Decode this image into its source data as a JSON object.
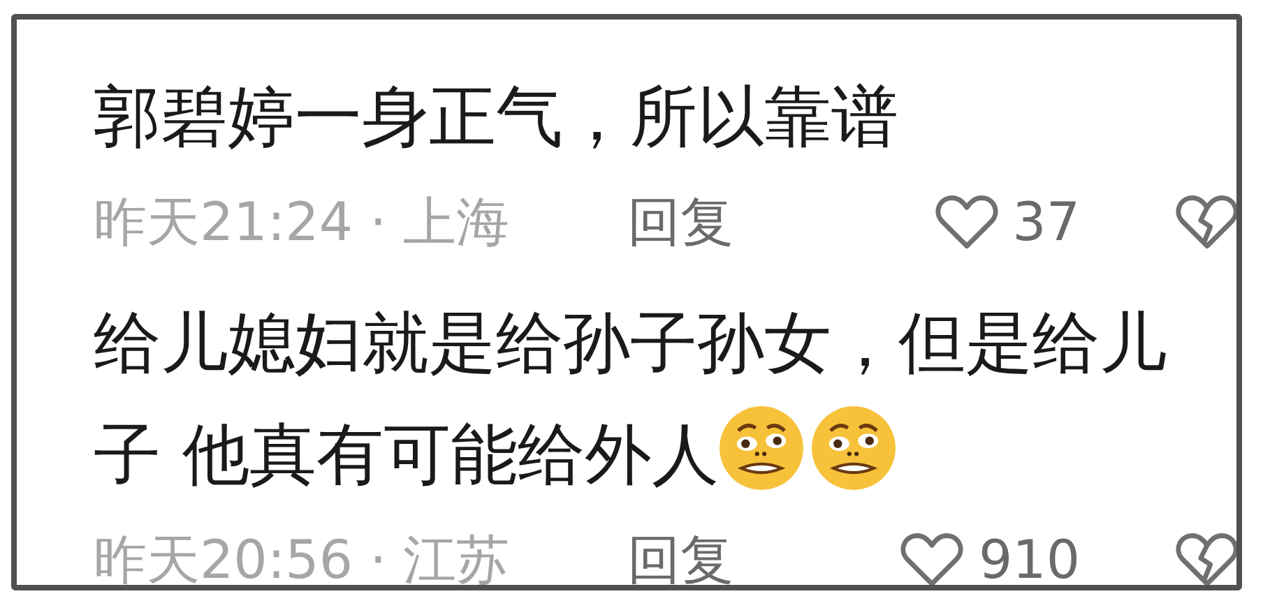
{
  "comments": [
    {
      "lines": [
        "郭碧婷一身正气，所以靠谱"
      ],
      "time_location": "昨天21:24 · 上海",
      "reply": "回复",
      "likes": "37"
    },
    {
      "lines": [
        "给儿媳妇就是给孙子孙女，但是给儿",
        "子 他真有可能给外人"
      ],
      "emojis": [
        {
          "kind": "grimace"
        },
        {
          "kind": "grimace"
        }
      ],
      "time_location": "昨天20:56 · 江苏",
      "reply": "回复",
      "likes": "910"
    }
  ]
}
